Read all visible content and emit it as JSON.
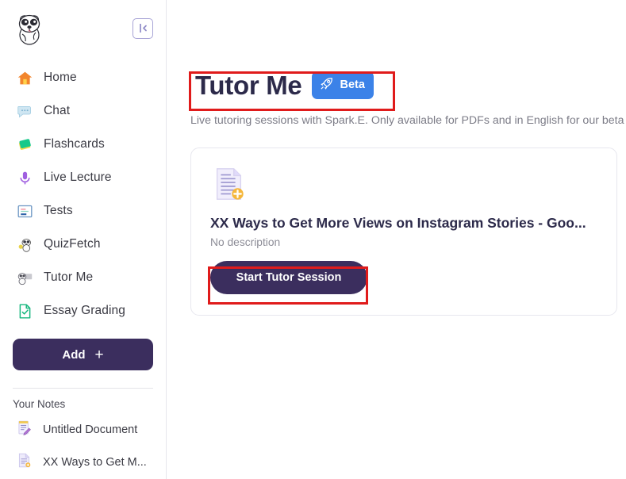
{
  "sidebar": {
    "logo_alt": "spark-dog-mascot",
    "collapse_label": "collapse-sidebar",
    "nav_items": [
      {
        "label": "Home",
        "icon": "home-icon"
      },
      {
        "label": "Chat",
        "icon": "chat-icon"
      },
      {
        "label": "Flashcards",
        "icon": "flashcards-icon"
      },
      {
        "label": "Live Lecture",
        "icon": "microphone-icon"
      },
      {
        "label": "Tests",
        "icon": "tests-icon"
      },
      {
        "label": "QuizFetch",
        "icon": "quizfetch-dog-icon"
      },
      {
        "label": "Tutor Me",
        "icon": "tutor-me-dog-icon"
      },
      {
        "label": "Essay Grading",
        "icon": "essay-grading-icon"
      }
    ],
    "add_button": {
      "label": "Add",
      "plus": "+"
    },
    "notes_heading": "Your Notes",
    "notes": [
      {
        "label": "Untitled Document",
        "icon": "note-pencil-icon"
      },
      {
        "label": "XX Ways to Get M...",
        "icon": "document-icon"
      }
    ]
  },
  "main": {
    "title": "Tutor Me",
    "beta_badge": "Beta",
    "beta_icon": "rocket-icon",
    "subtitle": "Live tutoring sessions with Spark.E. Only available for PDFs and in English for our beta",
    "card": {
      "doc_icon": "document-add-icon",
      "doc_title": "XX Ways to Get More Views on Instagram Stories - Goo...",
      "doc_description": "No description",
      "start_button": "Start Tutor Session"
    }
  },
  "colors": {
    "brand_purple": "#3b2e5e",
    "title_navy": "#2c2a4a",
    "beta_blue": "#3b82e8",
    "annotation_red": "#e01b1b",
    "muted_text": "#7d7d88"
  }
}
